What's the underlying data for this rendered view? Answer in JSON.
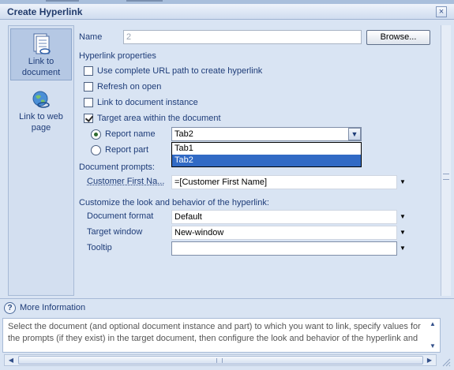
{
  "window": {
    "title": "Create Hyperlink",
    "close_label": "×"
  },
  "left_nav": {
    "items": [
      {
        "label": "Link to document",
        "icon": "document-link-icon",
        "selected": true
      },
      {
        "label": "Link to web page",
        "icon": "web-globe-icon",
        "selected": false
      }
    ]
  },
  "form": {
    "name_label": "Name",
    "name_value": "2",
    "browse_button": "Browse...",
    "hyperlink_properties_heading": "Hyperlink properties",
    "checkboxes": [
      {
        "label": "Use complete URL path to create hyperlink",
        "checked": false
      },
      {
        "label": "Refresh on open",
        "checked": false
      },
      {
        "label": "Link to document instance",
        "checked": false
      },
      {
        "label": "Target area within the document",
        "checked": true
      }
    ],
    "radios": [
      {
        "label": "Report name",
        "checked": true
      },
      {
        "label": "Report part",
        "checked": false
      }
    ],
    "report_name_value": "Tab2",
    "report_name_options": [
      "Tab1",
      "Tab2"
    ],
    "report_name_selected_option": "Tab2",
    "document_prompts_heading": "Document prompts:",
    "prompt_label": "Customer First Na...",
    "prompt_value": "=[Customer First Name]",
    "customize_heading": "Customize the look and behavior of the hyperlink:",
    "document_format_label": "Document format",
    "document_format_value": "Default",
    "target_window_label": "Target window",
    "target_window_value": "New-window",
    "tooltip_label": "Tooltip",
    "tooltip_value": ""
  },
  "more_info": {
    "label": "More Information",
    "help_text": "Select the document (and optional document instance and part) to which you want to link, specify values for the prompts (if they exist) in the target document, then configure the look and behavior of the hyperlink and"
  },
  "colors": {
    "background": "#d9e4f3",
    "label_text": "#1e3c78",
    "selection": "#316ac5"
  }
}
